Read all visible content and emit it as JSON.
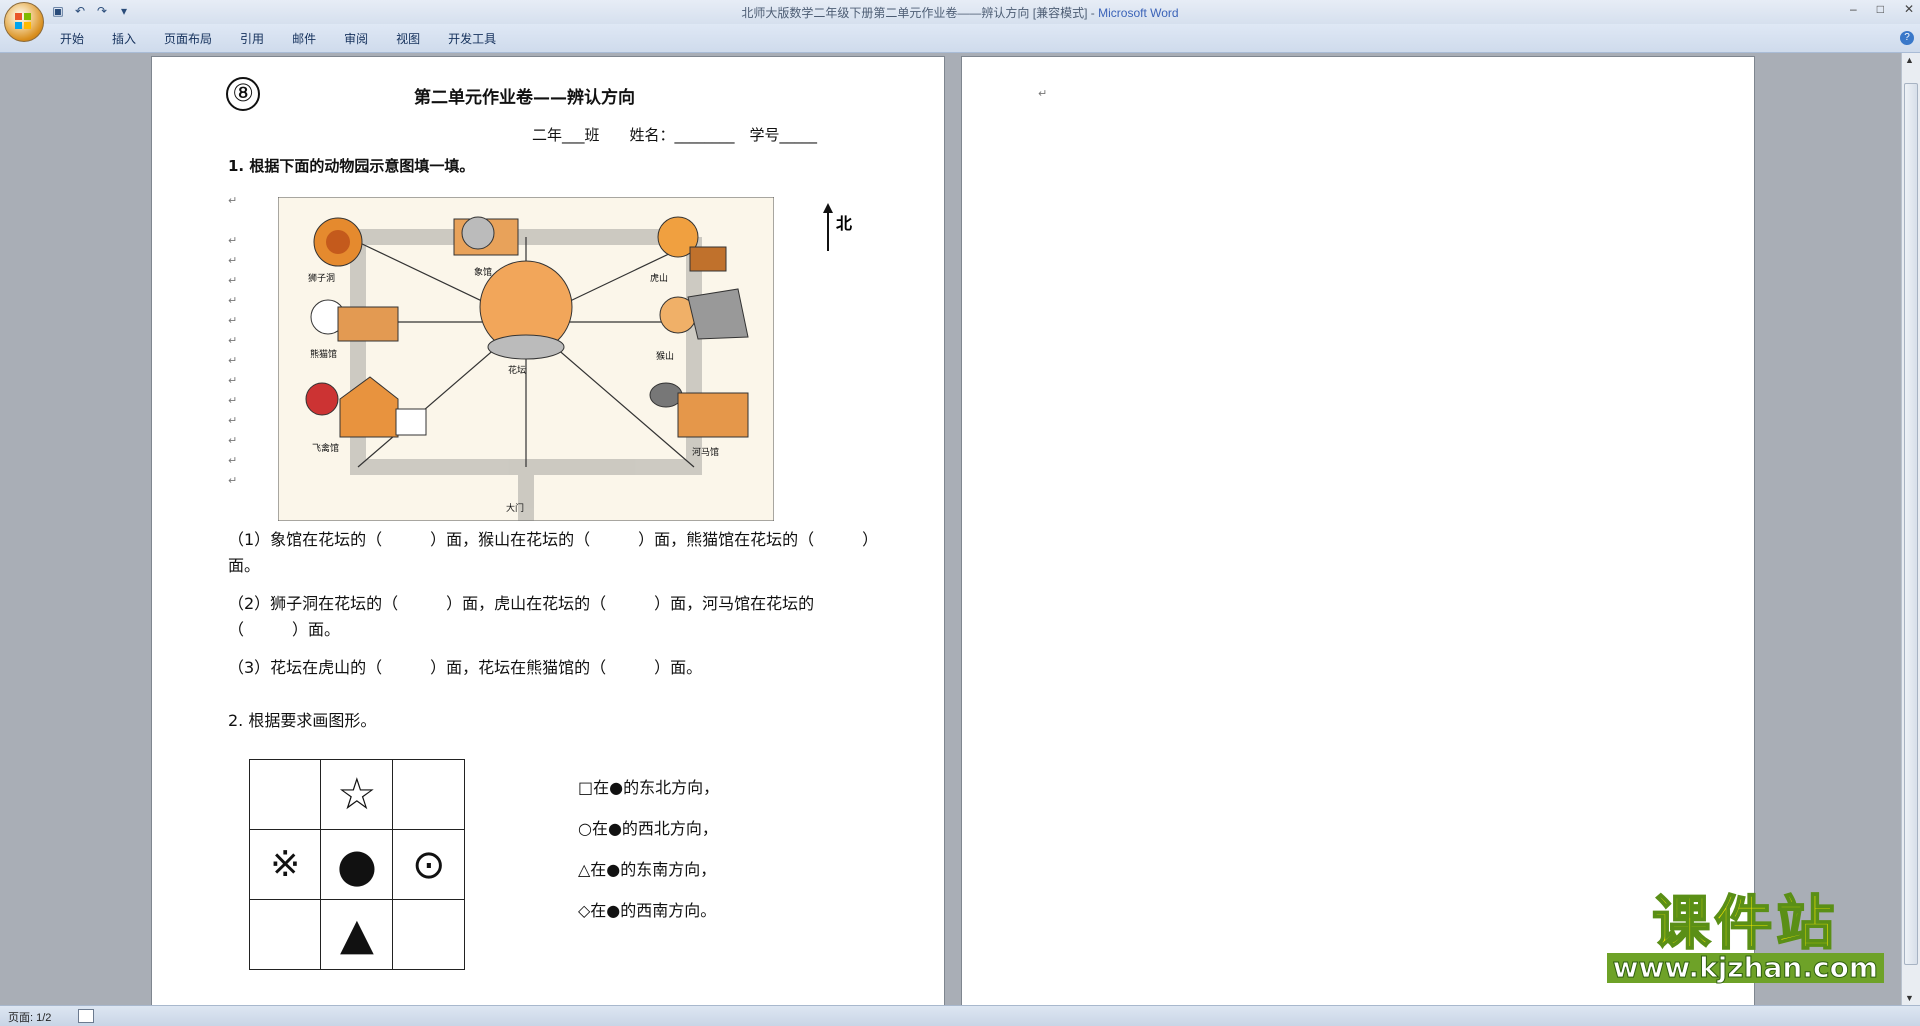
{
  "window": {
    "title": "北师大版数学二年级下册第二单元作业卷——辨认方向 [兼容模式] -",
    "app_name": "Microsoft Word",
    "controls": [
      "–",
      "□",
      "✕"
    ]
  },
  "qat": {
    "save": "save-icon",
    "undo": "undo-icon",
    "redo": "redo-icon",
    "more": "▾"
  },
  "ribbon": {
    "tabs": [
      "开始",
      "插入",
      "页面布局",
      "引用",
      "邮件",
      "审阅",
      "视图",
      "开发工具"
    ],
    "help": "?"
  },
  "document": {
    "page1": {
      "number_badge": "⑧",
      "title": "第二单元作业卷——辨认方向",
      "student_info": "二年___班　　姓名：________　学号_____",
      "q1_title": "1.  根据下面的动物园示意图填一填。",
      "map": {
        "labels": {
          "lion": "狮子洞",
          "elephant": "象馆",
          "tiger": "虎山",
          "panda": "熊猫馆",
          "flower": "花坛",
          "monkey": "猴山",
          "bird": "飞禽馆",
          "gate": "大门",
          "hippo": "河马馆"
        },
        "north": "北"
      },
      "q1_items": [
        "（1）象馆在花坛的（　　　）面，猴山在花坛的（　　　）面，熊猫馆在花坛的（　　　）面。",
        "（2）狮子洞在花坛的（　　　）面，虎山在花坛的（　　　）面，河马馆在花坛的（　　　）面。",
        "（3）花坛在虎山的（　　　）面，花坛在熊猫馆的（　　　）面。"
      ],
      "q2_title": "2. 根据要求画图形。",
      "grid_symbols": [
        "",
        "☆",
        "",
        "※",
        "●",
        "⊙",
        "",
        "▲",
        ""
      ],
      "rules": [
        "□在●的东北方向，",
        "○在●的西北方向，",
        "△在●的东南方向，",
        "◇在●的西南方向。"
      ]
    },
    "page2": {
      "paragraph_mark": "↵"
    }
  },
  "status_bar": {
    "page": "页面: 1/2"
  },
  "watermark": {
    "text": "课件站",
    "url": "www.kjzhan.com"
  },
  "colors": {
    "ribbon_bg": "#d6e0ee",
    "workspace": "#a9aeb6",
    "title_app": "#3b63b8",
    "watermark_fill": "#f5e800"
  }
}
